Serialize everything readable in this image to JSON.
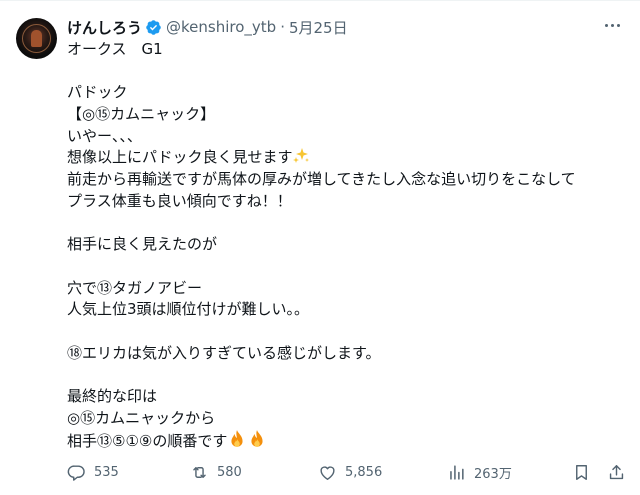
{
  "author": {
    "name": "けんしろう",
    "handle": "@kenshiro_ytb",
    "separator": "·",
    "date": "5月25日",
    "verified": true
  },
  "tweet": {
    "lines": [
      "オークス　G1",
      "",
      "パドック",
      "【◎⑮カムニャック】",
      "いやー、、、",
      "想像以上にパドック良く見せます",
      "前走から再輸送ですが馬体の厚みが増してきたし入念な追い切りをこなして",
      "プラス体重も良い傾向ですね！！",
      "",
      "相手に良く見えたのが",
      "",
      "穴で⑬タガノアビー",
      "人気上位3頭は順位付けが難しい。。",
      "",
      "⑱エリカは気が入りすぎている感じがします。",
      "",
      "最終的な印は",
      "◎⑮カムニャックから",
      "相手⑬⑤①⑨の順番です"
    ]
  },
  "actions": {
    "reply_count": "535",
    "retweet_count": "580",
    "like_count": "5,856",
    "view_count": "263万"
  },
  "colors": {
    "text": "#0f1419",
    "secondary": "#536471",
    "verified": "#1d9bf0",
    "sparkle": "#f7c531",
    "fire": "#f4900c"
  },
  "icons": {
    "verified": "verified-badge-icon",
    "more": "more-options-icon",
    "sparkle": "sparkles-emoji",
    "fire": "fire-emoji",
    "reply": "reply-icon",
    "retweet": "retweet-icon",
    "like": "heart-icon",
    "views": "views-icon",
    "bookmark": "bookmark-icon",
    "share": "share-icon"
  }
}
